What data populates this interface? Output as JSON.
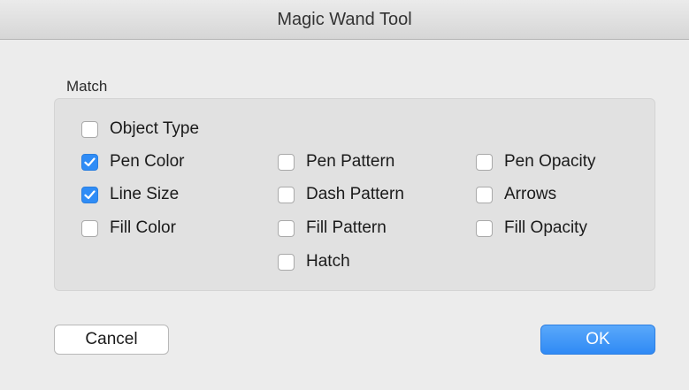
{
  "window": {
    "title": "Magic Wand Tool"
  },
  "match_group": {
    "label": "Match",
    "options": {
      "object_type": {
        "label": "Object Type",
        "checked": false
      },
      "pen_color": {
        "label": "Pen Color",
        "checked": true
      },
      "line_size": {
        "label": "Line Size",
        "checked": true
      },
      "fill_color": {
        "label": "Fill Color",
        "checked": false
      },
      "pen_pattern": {
        "label": "Pen Pattern",
        "checked": false
      },
      "dash_pattern": {
        "label": "Dash Pattern",
        "checked": false
      },
      "fill_pattern": {
        "label": "Fill Pattern",
        "checked": false
      },
      "hatch": {
        "label": "Hatch",
        "checked": false
      },
      "pen_opacity": {
        "label": "Pen Opacity",
        "checked": false
      },
      "arrows": {
        "label": "Arrows",
        "checked": false
      },
      "fill_opacity": {
        "label": "Fill Opacity",
        "checked": false
      }
    }
  },
  "buttons": {
    "cancel_label": "Cancel",
    "ok_label": "OK"
  },
  "colors": {
    "accent": "#2f8cf6",
    "background": "#ececec",
    "group_background": "#e1e1e1"
  }
}
